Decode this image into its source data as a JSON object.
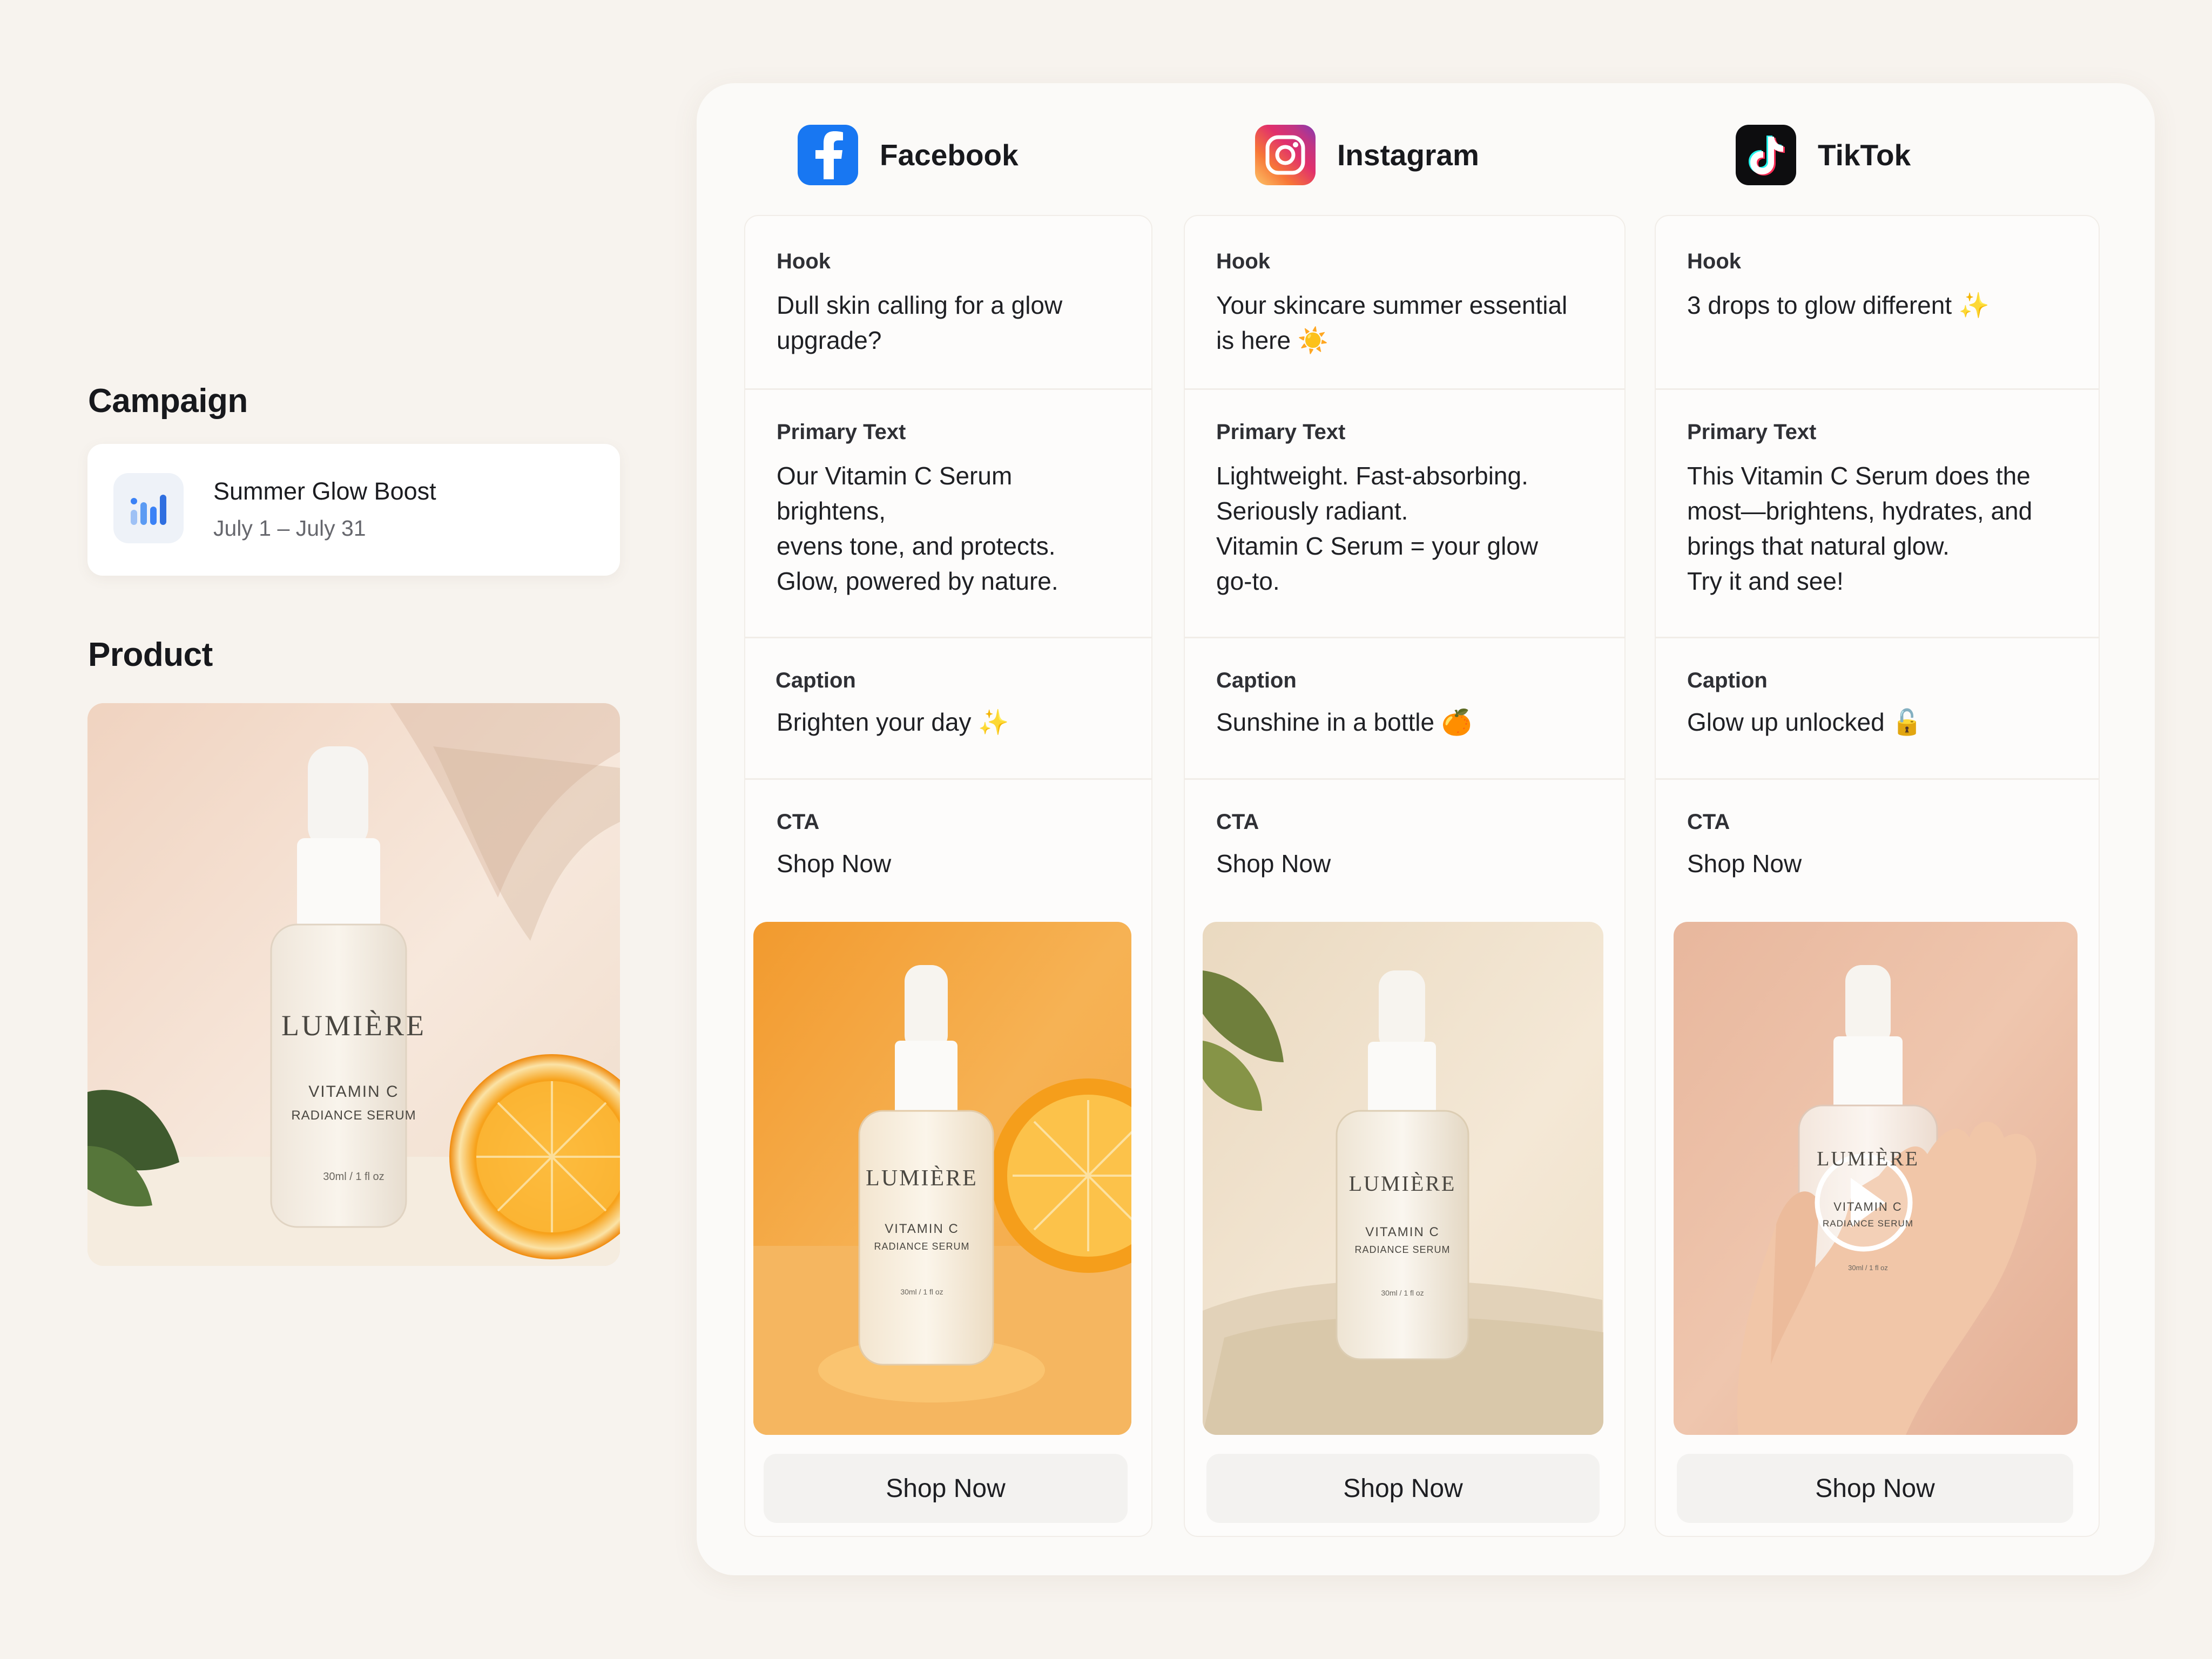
{
  "campaign": {
    "heading": "Campaign",
    "name": "Summer Glow Boost",
    "dates": "July 1 – July 31",
    "icon": "bar-chart-icon",
    "accent": "#3b82f6"
  },
  "product": {
    "heading": "Product",
    "brand": "LUMIÈRE",
    "line1": "VITAMIN C",
    "line2": "RADIANCE SERUM",
    "size": "30ml / 1 fl oz"
  },
  "platforms": [
    {
      "name": "Facebook",
      "icon": "facebook-icon",
      "color": "#1877f2",
      "hook_label": "Hook",
      "hook": "Dull skin calling for a glow\nupgrade?",
      "primary_label": "Primary Text",
      "primary": "Our Vitamin C Serum brightens,\nevens tone, and protects.\nGlow, powered by nature.",
      "caption_label": "Caption",
      "caption": "Brighten your day ✨",
      "cta_label": "CTA",
      "cta": "Shop Now",
      "button": "Shop Now"
    },
    {
      "name": "Instagram",
      "icon": "instagram-icon",
      "color": "#dd2a7b",
      "hook_label": "Hook",
      "hook": "Your skincare summer essential\nis here ☀️",
      "primary_label": "Primary Text",
      "primary": "Lightweight. Fast-absorbing.\nSeriously radiant.\nVitamin C Serum = your glow\ngo-to.",
      "caption_label": "Caption",
      "caption": "Sunshine in a bottle 🍊",
      "cta_label": "CTA",
      "cta": "Shop Now",
      "button": "Shop Now"
    },
    {
      "name": "TikTok",
      "icon": "tiktok-icon",
      "color": "#000000",
      "hook_label": "Hook",
      "hook": "3 drops to glow different ✨",
      "primary_label": "Primary Text",
      "primary": "This Vitamin C Serum does the\nmost—brightens, hydrates, and\nbrings that natural glow.\nTry it and see!",
      "caption_label": "Caption",
      "caption": "Glow up unlocked 🔓",
      "cta_label": "CTA",
      "cta": "Shop Now",
      "button": "Shop Now"
    }
  ]
}
